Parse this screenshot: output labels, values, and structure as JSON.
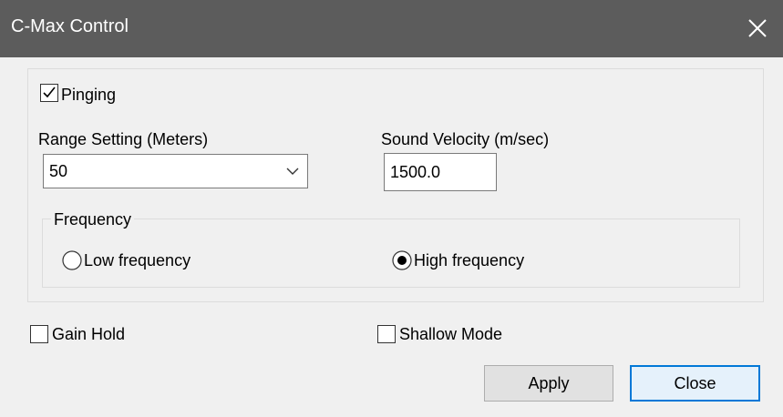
{
  "window": {
    "title": "C-Max Control"
  },
  "pinging": {
    "label": "Pinging",
    "checked": true
  },
  "range": {
    "label": "Range Setting (Meters)",
    "value": "50"
  },
  "sound_velocity": {
    "label": "Sound Velocity (m/sec)",
    "value": "1500.0"
  },
  "frequency": {
    "legend": "Frequency",
    "options": [
      {
        "label": "Low frequency",
        "selected": false
      },
      {
        "label": "High frequency",
        "selected": true
      }
    ]
  },
  "gain_hold": {
    "label": "Gain Hold",
    "checked": false
  },
  "shallow_mode": {
    "label": "Shallow Mode",
    "checked": false
  },
  "buttons": {
    "apply": "Apply",
    "close": "Close"
  },
  "colors": {
    "titlebar": "#5c5c5c",
    "dialog_bg": "#f0f0f0",
    "default_button_border": "#0078d7"
  },
  "icons": {
    "close": "close-icon",
    "dropdown": "chevron-down-icon"
  }
}
